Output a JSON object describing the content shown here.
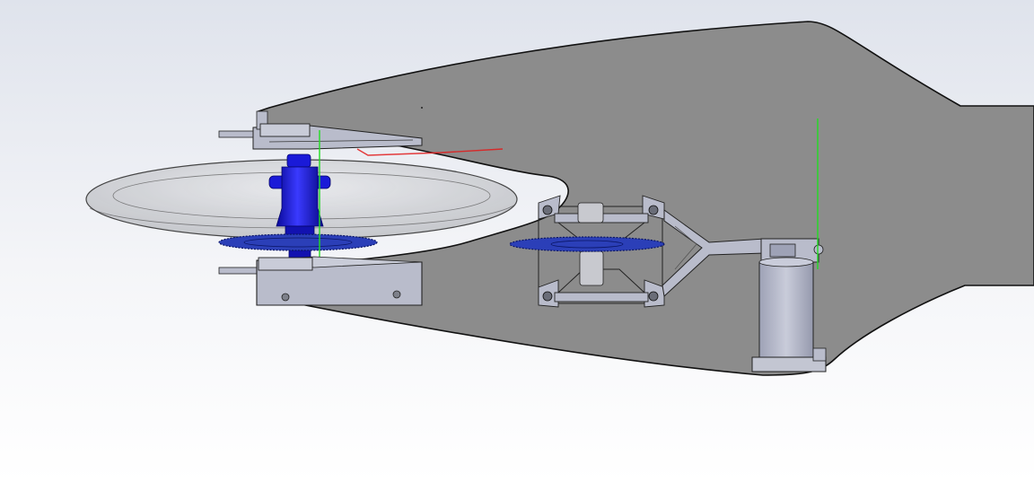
{
  "viewport": {
    "background_top": "#dfe3ec",
    "background_bottom": "#ffffff",
    "edge_color": "#111111"
  },
  "model": {
    "hull_color": "#8c8c8c",
    "tire_color": "#c8c9cc",
    "hub_color": "#1a1ad8",
    "sprocket_color": "#2b3fb8",
    "bracket_color": "#b9bccb",
    "motor_color": "#adb1c4",
    "axis_green": "#22dd22",
    "axis_red": "#e21a1a"
  }
}
